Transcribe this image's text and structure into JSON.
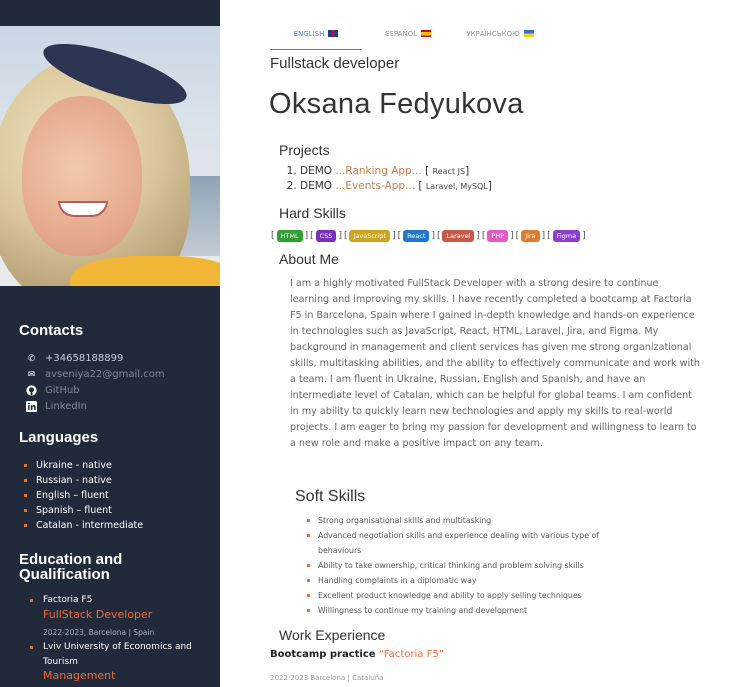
{
  "sidebar": {
    "contacts_title": "Contacts",
    "contacts": [
      {
        "icon": "phone-icon",
        "text": "+34658188899"
      },
      {
        "icon": "mail-icon",
        "text": "avseniya22@gmail.com"
      },
      {
        "icon": "github-icon",
        "text": "GitHub"
      },
      {
        "icon": "linkedin-icon",
        "text": "LinkedIn"
      }
    ],
    "languages_title": "Languages",
    "languages": [
      "Ukraine - native",
      "Russian - native",
      "English – fluent",
      "Spanish – fluent",
      "Catalan - intermediate"
    ],
    "education_title_line1": "Education and",
    "education_title_line2": "Qualification",
    "education": [
      {
        "school": "Factoria F5",
        "role": "FullStack Developer",
        "date": "2022-2023, Barcelona | Spain"
      },
      {
        "school_line1": "Lviv University of Economics and",
        "school_line2": "Tourism",
        "role": "Management"
      }
    ]
  },
  "tabs": [
    {
      "label": "ENGLISH",
      "flag": "uk",
      "active": true
    },
    {
      "label": "ESPAÑOL",
      "flag": "es",
      "active": false
    },
    {
      "label": "УКРАЇНСЬКОЮ",
      "flag": "ua",
      "active": false
    }
  ],
  "header": {
    "subtitle": "Fullstack developer",
    "name": "Oksana Fedyukova"
  },
  "projects": {
    "title": "Projects",
    "items": [
      {
        "prefix": "DEMO ",
        "link": "...Ranking App...",
        "stack": "React JS"
      },
      {
        "prefix": "DEMO ",
        "link": "...Events-App...",
        "stack": "Laravel, MySQL"
      }
    ]
  },
  "hard_skills": {
    "title": "Hard Skills",
    "items": [
      {
        "label": "HTML",
        "color": "#2e9e2e"
      },
      {
        "label": "CSS",
        "color": "#7b2fbf"
      },
      {
        "label": "JavaScript",
        "color": "#cfa51c"
      },
      {
        "label": "React",
        "color": "#1f78c8"
      },
      {
        "label": "Laravel",
        "color": "#c65a45"
      },
      {
        "label": "PHP",
        "color": "#e05bc4"
      },
      {
        "label": "Jira",
        "color": "#e07a2f"
      },
      {
        "label": "Figma",
        "color": "#8a3fd1"
      }
    ]
  },
  "about": {
    "title": "About Me",
    "text": "I am a highly motivated FullStack Developer with a strong desire to continue learning and improving my skills. I have recently completed a bootcamp at Factoria F5 in Barcelona, Spain where I gained in-depth knowledge and hands-on experience in technologies such as JavaScript, React, HTML, Laravel, Jira, and Figma. My background in management and client services has given me strong organizational skills, multitasking abilities, and the ability to effectively communicate and work with a team. I am fluent in Ukraine, Russian, English and Spanish, and have an intermediate level of Catalan, which can be helpful for global teams. I am confident in my ability to quickly learn new technologies and apply my skills to real-world projects. I am eager to bring my passion for development and willingness to learn to a new role and make a positive impact on any team."
  },
  "soft_skills": {
    "title": "Soft Skills",
    "items": [
      "Strong organisational skills and multitasking",
      "Advanced negotiation skills and experience dealing with various type of behaviours",
      "Ability to take ownership, critical thinking and problem solving skills",
      "Handling complaints in a diplomatic way",
      "Excellent product knowledge and ability to apply selling techniques",
      "Willingness to continue my training and development"
    ]
  },
  "work": {
    "title": "Work Experience",
    "job_prefix": "Bootcamp practice ",
    "job_company": "“Factoria F5”",
    "date": "2022-2023 Barcelona | Cataluña"
  }
}
